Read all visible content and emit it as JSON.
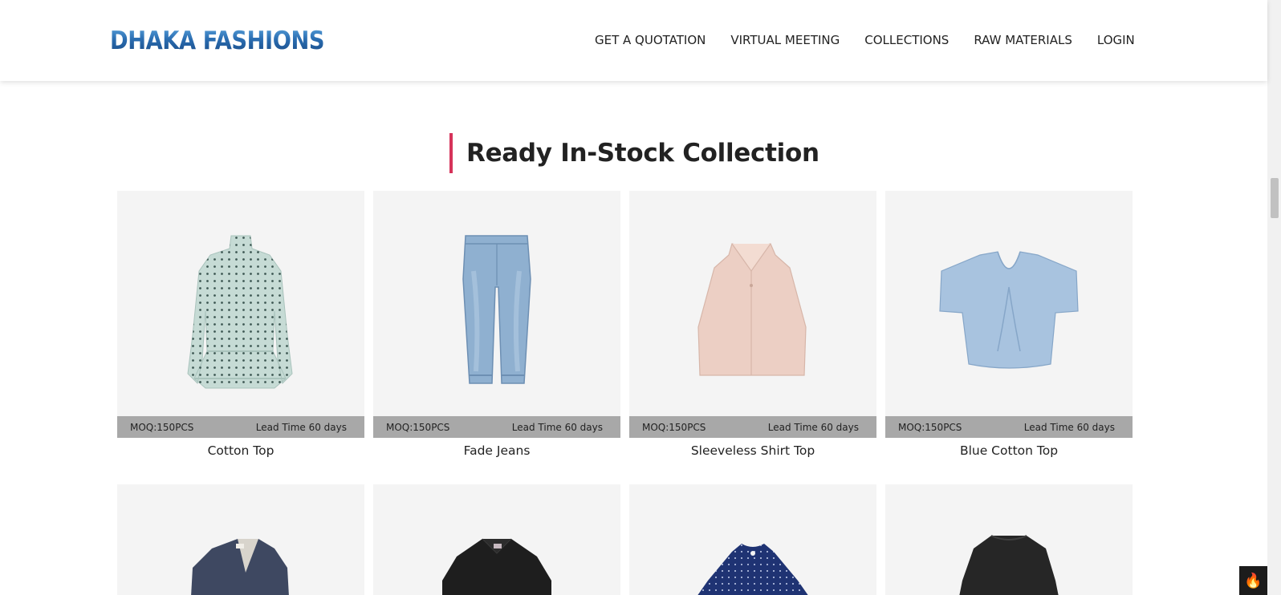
{
  "header": {
    "logo_text": "DHAKA FASHIONS",
    "nav": [
      {
        "label": "GET A QUOTATION"
      },
      {
        "label": "VIRTUAL MEETING"
      },
      {
        "label": "COLLECTIONS"
      },
      {
        "label": "RAW MATERIALS"
      },
      {
        "label": "LOGIN"
      }
    ]
  },
  "section": {
    "title": "Ready In-Stock Collection",
    "accent_color": "#d6335a"
  },
  "products": [
    {
      "name": "Cotton Top",
      "moq": "MOQ:150PCS",
      "lead_time": "Lead Time 60 days",
      "icon": "sheer-polka-dot-dress-image"
    },
    {
      "name": "Fade Jeans",
      "moq": "MOQ:150PCS",
      "lead_time": "Lead Time 60 days",
      "icon": "jeans-image"
    },
    {
      "name": "Sleeveless Shirt Top",
      "moq": "MOQ:150PCS",
      "lead_time": "Lead Time 60 days",
      "icon": "sleeveless-shirt-image"
    },
    {
      "name": "Blue Cotton Top",
      "moq": "MOQ:150PCS",
      "lead_time": "Lead Time 60 days",
      "icon": "blue-crop-top-image"
    }
  ],
  "products_row2": [
    {
      "icon": "denim-jacket-image"
    },
    {
      "icon": "black-shirt-image"
    },
    {
      "icon": "navy-polka-top-image"
    },
    {
      "icon": "black-cape-top-image"
    }
  ],
  "fire_button": {
    "icon": "fire-icon"
  }
}
